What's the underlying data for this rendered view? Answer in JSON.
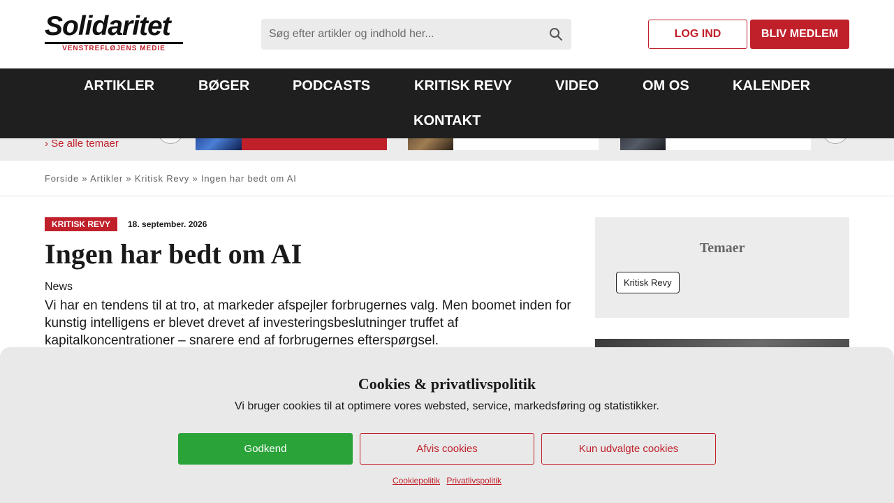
{
  "header": {
    "logo_text": "Solidaritet",
    "logo_tagline": "VENSTREFLØJENS MEDIE",
    "search_placeholder": "Søg efter artikler og indhold her...",
    "login_label": "LOG IND",
    "member_label": "BLIV MEDLEM"
  },
  "nav": {
    "items": [
      {
        "label": "ARTIKLER"
      },
      {
        "label": "BØGER"
      },
      {
        "label": "PODCASTS"
      },
      {
        "label": "KRITISK REVY"
      },
      {
        "label": "VIDEO"
      },
      {
        "label": "OM OS"
      },
      {
        "label": "KALENDER"
      },
      {
        "label": "KONTAKT"
      }
    ]
  },
  "strip": {
    "see_all_label": "Se alle temaer"
  },
  "breadcrumb": {
    "items": [
      "Forside",
      "Artikler",
      "Kritisk Revy",
      "Ingen har bedt om AI"
    ],
    "separator": "»"
  },
  "article": {
    "category": "KRITISK REVY",
    "date": "18. september. 2026",
    "title": "Ingen har bedt om AI",
    "kicker": "News",
    "lead": "Vi har en tendens til at tro, at markeder afspejler forbrugernes valg. Men boomet inden for kunstig intelligens er blevet drevet af investeringsbeslutninger truffet af kapitalkoncentrationer – snarere end af forbrugernes efterspørgsel."
  },
  "sidebar": {
    "themes_title": "Temaer",
    "tags": [
      "Kritisk Revy"
    ]
  },
  "cookie": {
    "title": "Cookies & privatlivspolitik",
    "text": "Vi bruger cookies til at optimere vores websted, service, markedsføring og statistikker.",
    "accept_label": "Godkend",
    "reject_label": "Afvis cookies",
    "select_label": "Kun udvalgte cookies",
    "link_cookie": "Cookiepolitik",
    "link_privacy": "Privatlivspolitik"
  },
  "colors": {
    "brand_red": "#c0202a",
    "nav_bg": "#1f1f1f",
    "accept_green": "#2aa339"
  }
}
